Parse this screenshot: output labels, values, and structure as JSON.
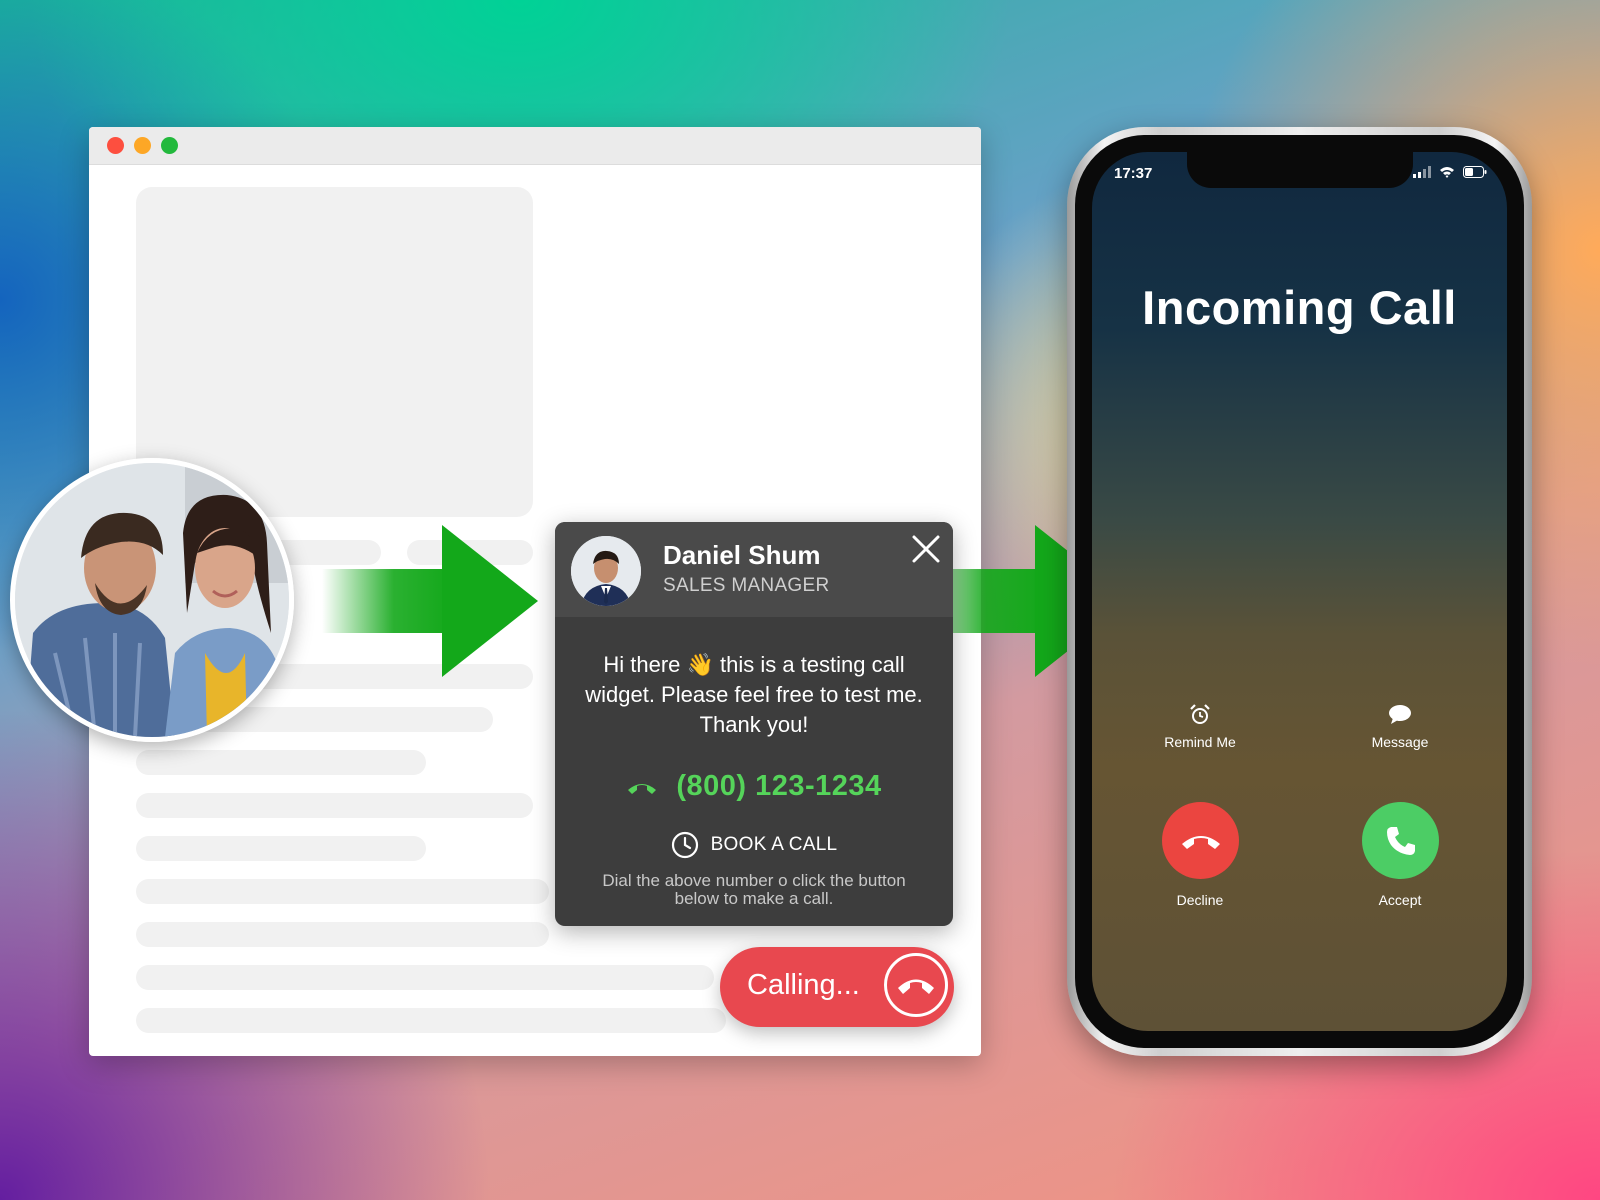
{
  "widget": {
    "agent_name": "Daniel Shum",
    "agent_role": "SALES MANAGER",
    "message": "Hi there 👋 this is a testing call widget. Please feel free to test me. Thank you!",
    "phone_number": "(800) 123-1234",
    "book_label": "BOOK A CALL",
    "note": "Dial the above number o click the button below to make a call."
  },
  "calling_button": {
    "label": "Calling..."
  },
  "phone": {
    "time": "17:37",
    "title": "Incoming Call",
    "options": [
      {
        "label": "Remind Me",
        "icon": "alarm-clock-icon"
      },
      {
        "label": "Message",
        "icon": "speech-bubble-icon"
      }
    ],
    "decline_label": "Decline",
    "accept_label": "Accept"
  },
  "colors": {
    "widget_bg": "#3d3d3d",
    "phone_green": "#55d45a",
    "calling_red": "#e8484f",
    "decline_red": "#eb4540",
    "accept_green": "#4ccd65",
    "arrow_green": "#13a81a"
  }
}
